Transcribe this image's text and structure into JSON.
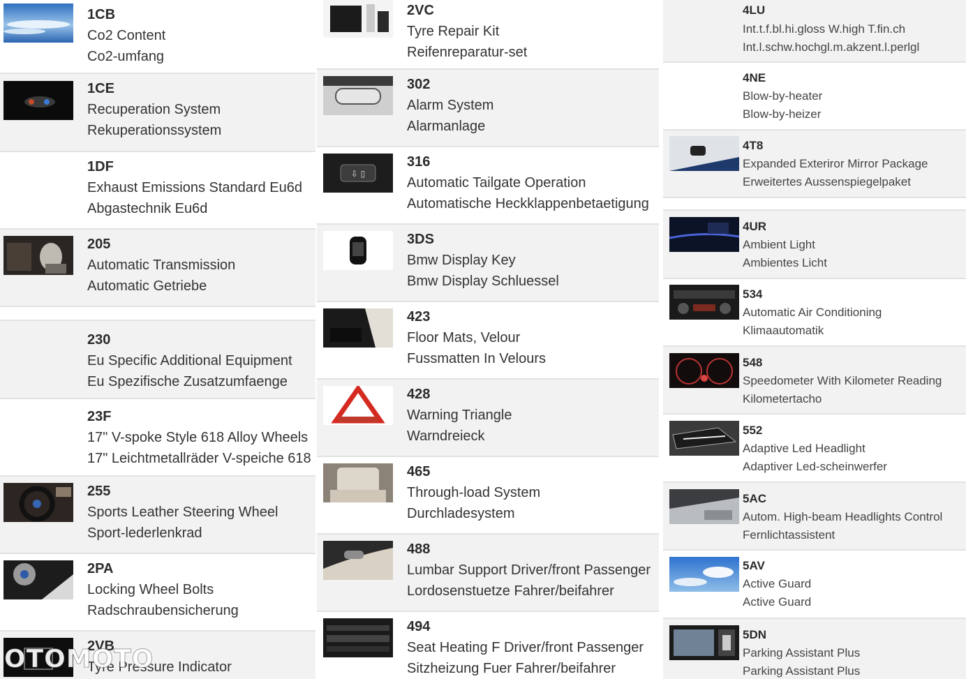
{
  "colors": {
    "row_shade": "#f2f2f2",
    "text": "#333333",
    "code_text": "#2b2b2b"
  },
  "columns": [
    [
      {
        "code": "1CB",
        "en": "Co2 Content",
        "de": "Co2-umfang",
        "thumb": "sky-clouds-image"
      },
      {
        "code": "1CE",
        "en": "Recuperation System",
        "de": "Rekuperationssystem",
        "thumb": "recuperation-display-image"
      },
      {
        "code": "1DF",
        "en": "Exhaust Emissions Standard Eu6d",
        "de": "Abgastechnik Eu6d",
        "thumb": ""
      },
      {
        "code": "205",
        "en": "Automatic Transmission",
        "de": "Automatic Getriebe",
        "thumb": "gear-selector-image"
      },
      {
        "code": "230",
        "en": "Eu Specific Additional Equipment",
        "de": "Eu Spezifische Zusatzumfaenge",
        "thumb": ""
      },
      {
        "code": "23F",
        "en": "17\" V-spoke Style 618 Alloy Wheels",
        "de": "17\" Leichtmetallräder V-speiche 618",
        "thumb": ""
      },
      {
        "code": "255",
        "en": "Sports Leather Steering Wheel",
        "de": "Sport-lederlenkrad",
        "thumb": "steering-wheel-image"
      },
      {
        "code": "2PA",
        "en": "Locking Wheel Bolts",
        "de": "Radschraubensicherung",
        "thumb": "alloy-wheel-image"
      },
      {
        "code": "2VB",
        "en": "Tyre Pressure Indicator",
        "de": "",
        "thumb": "tyre-pressure-display-image"
      }
    ],
    [
      {
        "code": "2VC",
        "en": "Tyre Repair Kit",
        "de": "Reifenreparatur-set",
        "thumb": "repair-kit-image"
      },
      {
        "code": "302",
        "en": "Alarm System",
        "de": "Alarmanlage",
        "thumb": "rear-mirror-image"
      },
      {
        "code": "316",
        "en": "Automatic Tailgate Operation",
        "de": "Automatische Heckklappenbetaetigung",
        "thumb": "tailgate-button-image"
      },
      {
        "code": "3DS",
        "en": "Bmw Display Key",
        "de": "Bmw Display Schluessel",
        "thumb": "display-key-image"
      },
      {
        "code": "423",
        "en": "Floor Mats, Velour",
        "de": "Fussmatten In Velours",
        "thumb": "floor-mats-image"
      },
      {
        "code": "428",
        "en": "Warning Triangle",
        "de": "Warndreieck",
        "thumb": "warning-triangle-image"
      },
      {
        "code": "465",
        "en": "Through-load System",
        "de": "Durchladesystem",
        "thumb": "rear-seats-image"
      },
      {
        "code": "488",
        "en": "Lumbar Support Driver/front Passenger",
        "de": "Lordosenstuetze Fahrer/beifahrer",
        "thumb": "seat-controls-image"
      },
      {
        "code": "494",
        "en": "Seat Heating F Driver/front Passenger",
        "de": "Sitzheizung Fuer Fahrer/beifahrer",
        "thumb": "climate-panel-image"
      }
    ],
    [
      {
        "code": "4LU",
        "en": "Int.t.f.bl.hi.gloss W.high T.fin.ch",
        "de": "Int.l.schw.hochgl.m.akzent.l.perlgl",
        "thumb": ""
      },
      {
        "code": "4NE",
        "en": "Blow-by-heater",
        "de": "Blow-by-heizer",
        "thumb": ""
      },
      {
        "code": "4T8",
        "en": "Expanded Exteriror Mirror Package",
        "de": "Erweitertes Aussenspiegelpaket",
        "thumb": "exterior-mirror-image"
      },
      {
        "code": "4UR",
        "en": "Ambient Light",
        "de": "Ambientes Licht",
        "thumb": "ambient-light-image"
      },
      {
        "code": "534",
        "en": "Automatic Air Conditioning",
        "de": "Klimaautomatik",
        "thumb": "air-conditioning-image"
      },
      {
        "code": "548",
        "en": "Speedometer With Kilometer Reading",
        "de": "Kilometertacho",
        "thumb": "speedometer-image"
      },
      {
        "code": "552",
        "en": "Adaptive Led Headlight",
        "de": "Adaptiver Led-scheinwerfer",
        "thumb": "headlight-image"
      },
      {
        "code": "5AC",
        "en": "Autom. High-beam Headlights Control",
        "de": "Fernlichtassistent",
        "thumb": "high-beam-image"
      },
      {
        "code": "5AV",
        "en": "Active Guard",
        "de": "Active Guard",
        "thumb": "sky-image"
      },
      {
        "code": "5DN",
        "en": "Parking Assistant Plus",
        "de": "Parking Assistant Plus",
        "thumb": "parking-camera-image"
      }
    ]
  ],
  "watermark": "OTOMOTO"
}
